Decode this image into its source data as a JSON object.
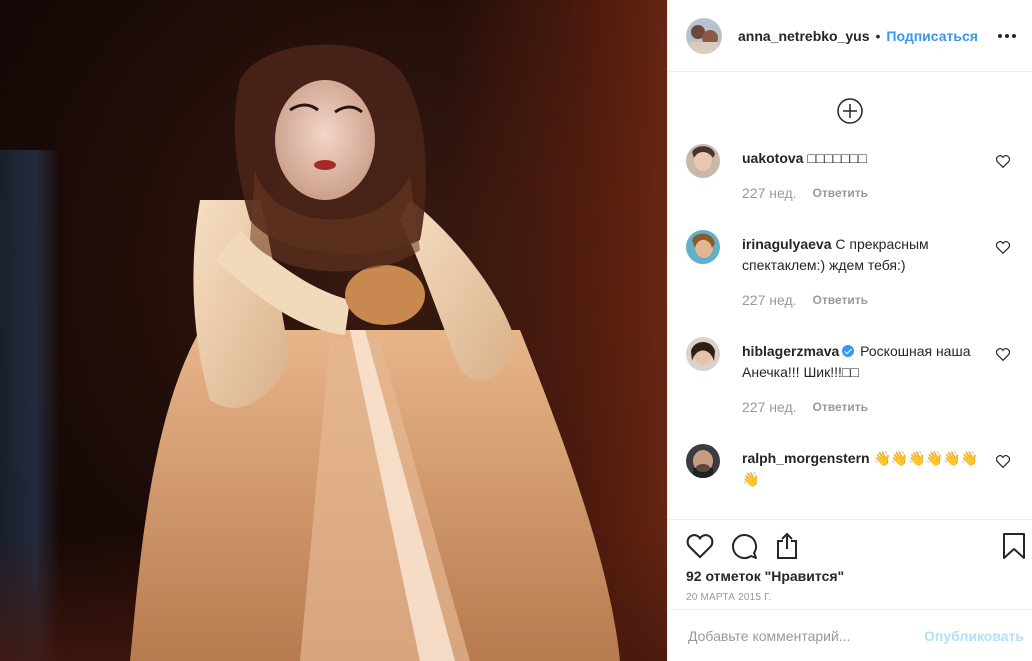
{
  "header": {
    "username": "anna_netrebko_yus",
    "separator": "•",
    "follow_label": "Подписаться"
  },
  "comments": [
    {
      "user": "uakotova",
      "verified": false,
      "text": "□□□□□□□",
      "age": "227 нед.",
      "reply_label": "Ответить"
    },
    {
      "user": "irinagulyaeva",
      "verified": false,
      "text": "С прекрасным спектаклем:) ждем тебя:)",
      "age": "227 нед.",
      "reply_label": "Ответить"
    },
    {
      "user": "hiblagerzmava",
      "verified": true,
      "text": "Роскошная наша Анечка!!! Шик!!!□□",
      "age": "227 нед.",
      "reply_label": "Ответить"
    },
    {
      "user": "ralph_morgenstern",
      "verified": false,
      "text": "👋👋👋👋👋👋👋",
      "age": "",
      "reply_label": ""
    }
  ],
  "post": {
    "likes_text": "92 отметок \"Нравится\"",
    "date": "20 МАРТА 2015 Г."
  },
  "composer": {
    "placeholder": "Добавьте комментарий...",
    "publish_label": "Опубликовать"
  },
  "colors": {
    "accent": "#3897f0",
    "publish_disabled": "#b2dffc",
    "muted": "#999999",
    "text": "#262626"
  },
  "icons": [
    "more-options-icon",
    "load-more-comments-icon",
    "heart-icon",
    "comment-icon",
    "share-icon",
    "bookmark-icon",
    "verified-badge-icon"
  ]
}
